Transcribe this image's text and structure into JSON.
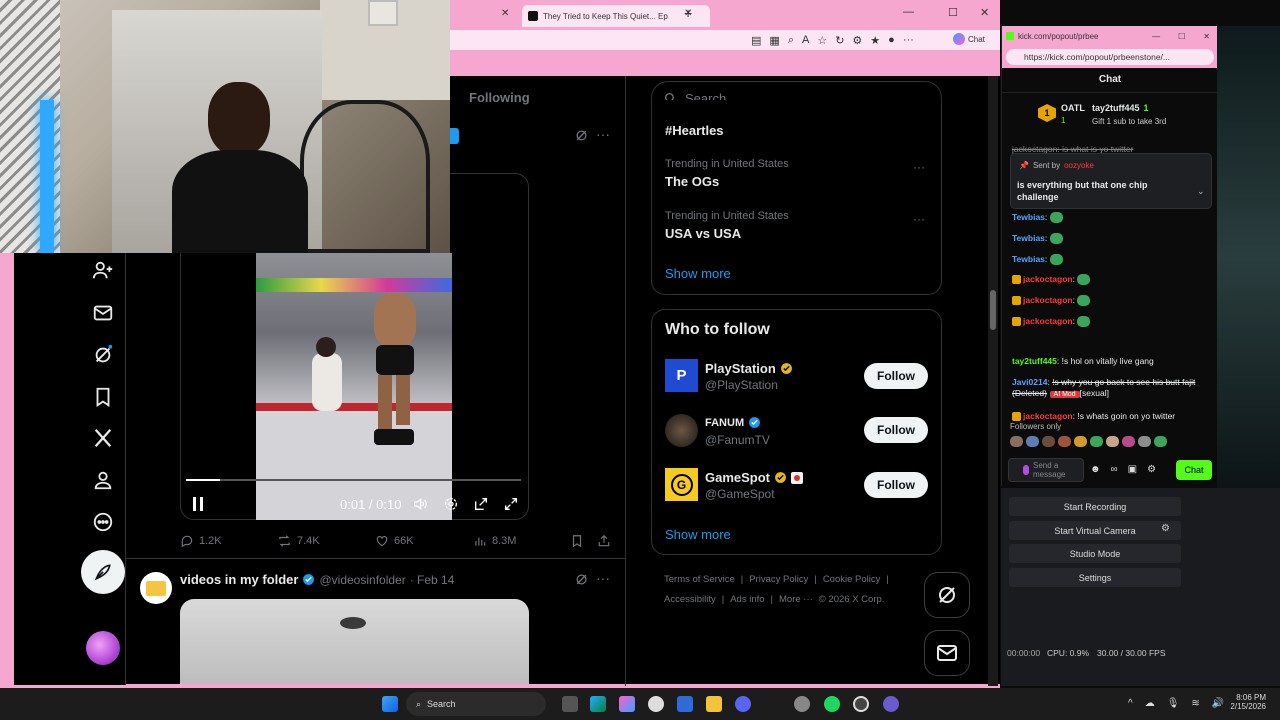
{
  "browser": {
    "tab_title": "They Tried to Keep This Quiet... Ep",
    "copilot_label": "Chat"
  },
  "x": {
    "following_tab": "Following",
    "search_placeholder": "Search",
    "trending": [
      {
        "context": "",
        "title": "#Heartles"
      },
      {
        "context": "Trending in United States",
        "title": "The OGs"
      },
      {
        "context": "Trending in United States",
        "title": "USA vs USA"
      }
    ],
    "show_more": "Show more",
    "who_to_follow": {
      "heading": "Who to follow",
      "accounts": [
        {
          "name": "PlayStation",
          "handle": "@PlayStation",
          "button": "Follow"
        },
        {
          "name": "FANUM",
          "handle": "@FanumTV",
          "button": "Follow"
        },
        {
          "name": "GameSpot",
          "handle": "@GameSpot",
          "button": "Follow"
        }
      ],
      "show_more": "Show more"
    },
    "footer": {
      "terms": "Terms of Service",
      "privacy": "Privacy Policy",
      "cookie": "Cookie Policy",
      "accessibility": "Accessibility",
      "ads": "Ads info",
      "more": "More ···",
      "copyright": "© 2026 X Corp."
    },
    "video": {
      "time": "0:01 / 0:10",
      "progress": 0.1
    },
    "post_actions": {
      "replies": "1.2K",
      "reposts": "7.4K",
      "likes": "66K",
      "views": "8.3M"
    },
    "next_post": {
      "author": "videos in my folder",
      "handle": "@videosinfolder",
      "date": "· Feb 14"
    }
  },
  "kick": {
    "url": "https://kick.com/popout/prbeenstone/...",
    "url_short": "kick.com/popout/prbee",
    "header": "Chat",
    "gifter_rank": "1",
    "gifter_name": "OATL",
    "gifter_count": "1",
    "top_user": "tay2tuff445",
    "top_user_count": "1",
    "gift_prompt": "Gift 1 sub to take 3rd",
    "partial_line": "jackoctagon: is what is yo twitter",
    "pinned_sent_by": "Sent by",
    "pinned_user": "oozyoke",
    "pinned_message": "is everything but that one chip challenge",
    "messages": [
      {
        "user": "Tewbias",
        "color": "#53a6ff",
        "text": ""
      },
      {
        "user": "Tewbias",
        "color": "#53a6ff",
        "text": ""
      },
      {
        "user": "Tewbias",
        "color": "#53a6ff",
        "text": ""
      },
      {
        "user": "jackoctagon",
        "color": "#ff3b3b",
        "text": ""
      },
      {
        "user": "jackoctagon",
        "color": "#ff3b3b",
        "text": ""
      },
      {
        "user": "jackoctagon",
        "color": "#ff3b3b",
        "text": ""
      },
      {
        "user": "tay2tuff445",
        "color": "#53fc18",
        "text": "!s hol on vitally live gang"
      },
      {
        "user": "Javi0214",
        "color": "#53a6ff",
        "text": "!s why you go back to see his butt fajit (Deleted)"
      },
      {
        "user": "jackoctagon",
        "color": "#ff3b3b",
        "text": "!s whats goin on yo twitter"
      }
    ],
    "ai_mod": "AI Mod",
    "sexual_tag": "[sexual]",
    "followers_only": "Followers only",
    "send_placeholder": "Send a message",
    "chat_button": "Chat"
  },
  "obs": {
    "start_recording": "Start Recording",
    "start_virtual_camera": "Start Virtual Camera",
    "studio_mode": "Studio Mode",
    "settings": "Settings",
    "timer": "00:00:00",
    "cpu": "CPU: 0.9%",
    "fps": "30.00 / 30.00 FPS"
  },
  "taskbar": {
    "search": "Search",
    "time": "8:06 PM",
    "date": "2/15/2026"
  }
}
